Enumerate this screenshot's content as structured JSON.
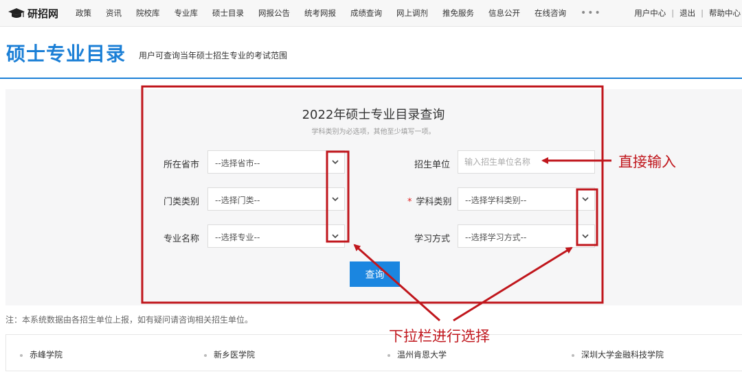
{
  "header": {
    "logo_text": "研招网",
    "nav": [
      "政策",
      "资讯",
      "院校库",
      "专业库",
      "硕士目录",
      "网报公告",
      "统考网报",
      "成绩查询",
      "网上调剂",
      "推免服务",
      "信息公开",
      "在线咨询"
    ],
    "more": "•••",
    "user_center": "用户中心",
    "sep1": "|",
    "logout": "退出",
    "sep2": "|",
    "help": "帮助中心"
  },
  "page": {
    "title": "硕士专业目录",
    "subtitle": "用户可查询当年硕士招生专业的考试范围"
  },
  "form": {
    "title": "2022年硕士专业目录查询",
    "hint": "学科类别为必选项，其他至少填写一项。",
    "province_label": "所在省市",
    "province_value": "--选择省市--",
    "category_label": "门类类别",
    "category_value": "--选择门类--",
    "major_label": "专业名称",
    "major_value": "--选择专业--",
    "school_label": "招生单位",
    "school_placeholder": "输入招生单位名称",
    "required_mark": "*",
    "subject_label": "学科类别",
    "subject_value": "--选择学科类别--",
    "mode_label": "学习方式",
    "mode_value": "--选择学习方式--",
    "query_button": "查询"
  },
  "note": "注：本系统数据由各招生单位上报，如有疑问请咨询相关招生单位。",
  "schools": [
    "赤峰学院",
    "新乡医学院",
    "温州肯恩大学",
    "深圳大学金融科技学院"
  ],
  "annotations": {
    "direct_input": "直接输入",
    "dropdown_select": "下拉栏进行选择"
  },
  "colors": {
    "brand_blue": "#1b7fd6",
    "button_blue": "#1b86e0",
    "annotation_red": "#c0161c"
  }
}
